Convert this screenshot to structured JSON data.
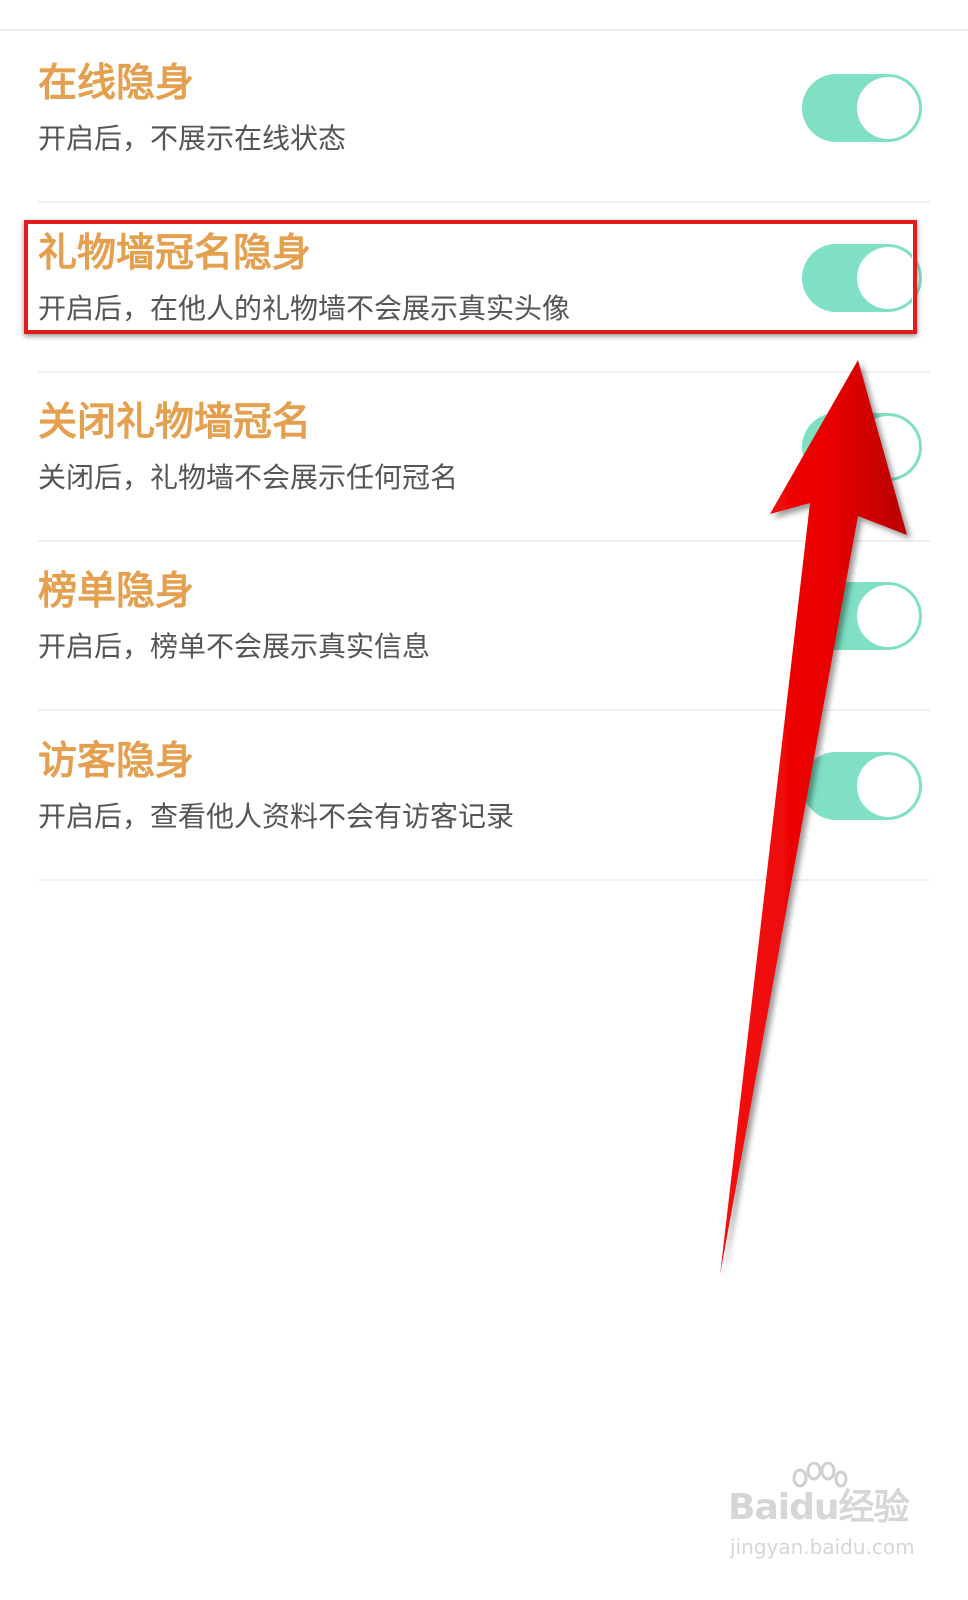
{
  "accent_color": "#e4a04e",
  "toggle_color": "#7fe0c4",
  "highlight_color": "#e01d1d",
  "settings": [
    {
      "title": "在线隐身",
      "desc": "开启后，不展示在线状态",
      "enabled": true
    },
    {
      "title": "礼物墙冠名隐身",
      "desc": "开启后，在他人的礼物墙不会展示真实头像",
      "enabled": true
    },
    {
      "title": "关闭礼物墙冠名",
      "desc": "关闭后，礼物墙不会展示任何冠名",
      "enabled": true
    },
    {
      "title": "榜单隐身",
      "desc": "开启后，榜单不会展示真实信息",
      "enabled": true
    },
    {
      "title": "访客隐身",
      "desc": "开启后，查看他人资料不会有访客记录",
      "enabled": true
    }
  ],
  "watermark": {
    "logo": "Baidu经验",
    "url": "jingyan.baidu.com"
  }
}
